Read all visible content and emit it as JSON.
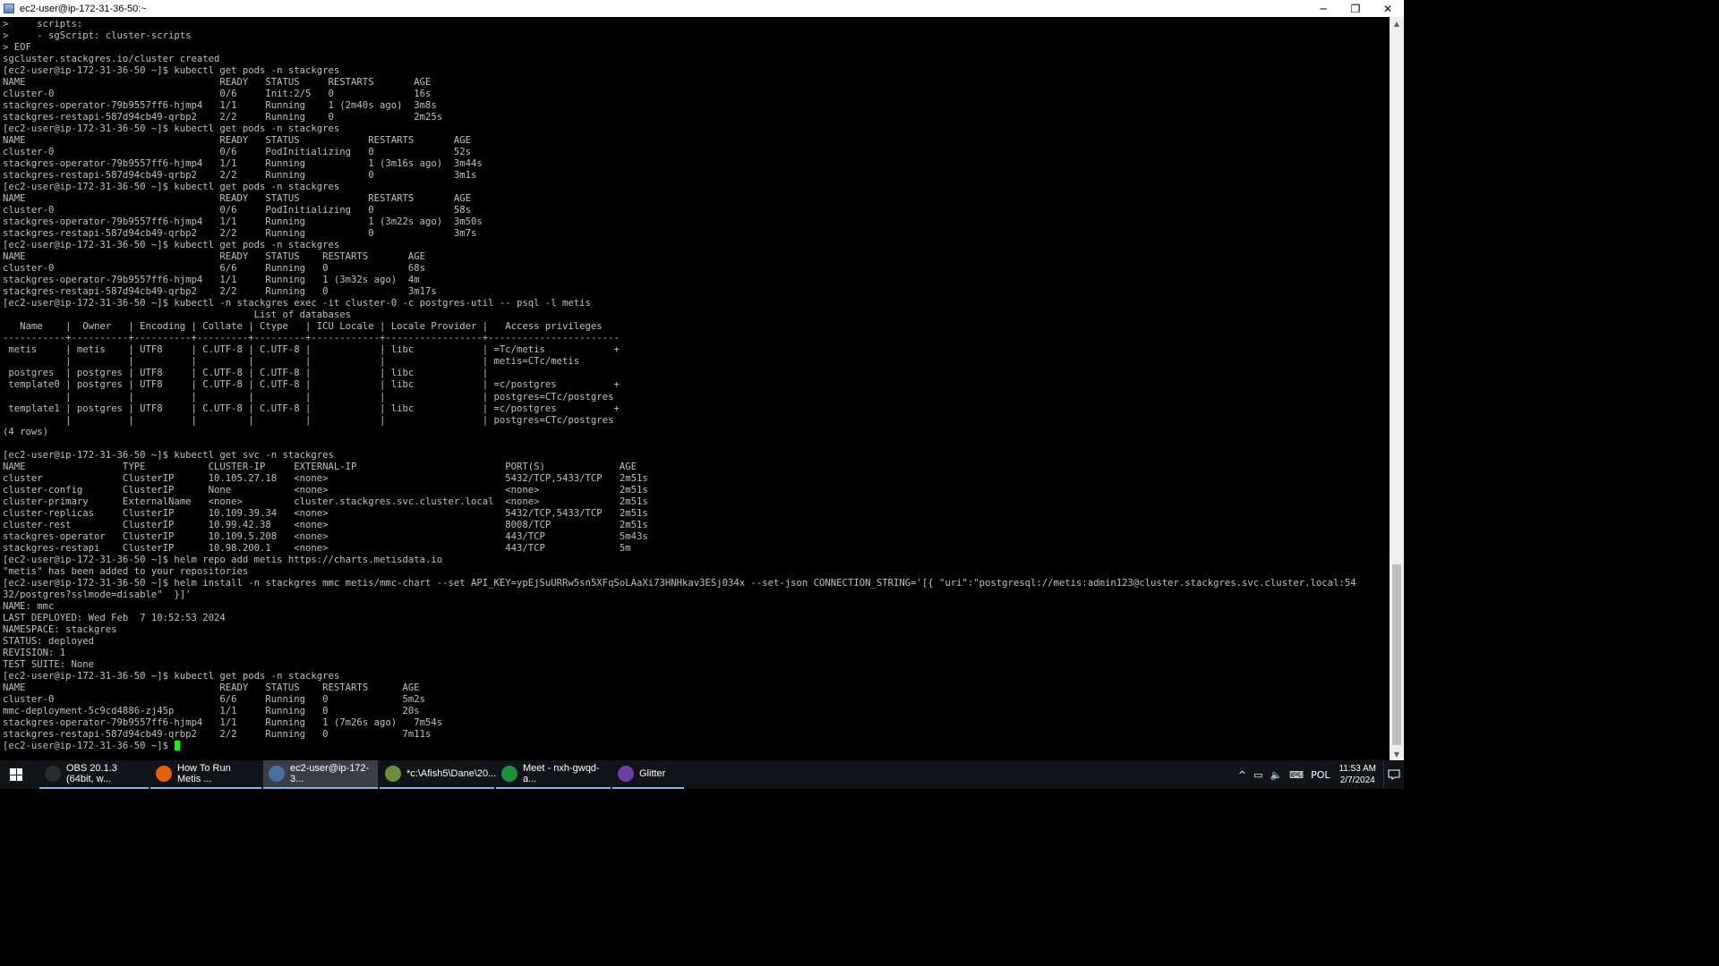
{
  "window": {
    "title": "ec2-user@ip-172-31-36-50:~",
    "minimize": "─",
    "maximize": "❐",
    "close": "✕"
  },
  "terminal": {
    "prompt": "[ec2-user@ip-172-31-36-50 ~]$ ",
    "lines": [
      ">     scripts:",
      ">     - sgScript: cluster-scripts",
      "> EOF",
      "sgcluster.stackgres.io/cluster created",
      "[ec2-user@ip-172-31-36-50 ~]$ kubectl get pods -n stackgres",
      "NAME                                  READY   STATUS     RESTARTS       AGE",
      "cluster-0                             0/6     Init:2/5   0              16s",
      "stackgres-operator-79b9557ff6-hjmp4   1/1     Running    1 (2m40s ago)  3m8s",
      "stackgres-restapi-587d94cb49-qrbp2    2/2     Running    0              2m25s",
      "[ec2-user@ip-172-31-36-50 ~]$ kubectl get pods -n stackgres",
      "NAME                                  READY   STATUS            RESTARTS       AGE",
      "cluster-0                             0/6     PodInitializing   0              52s",
      "stackgres-operator-79b9557ff6-hjmp4   1/1     Running           1 (3m16s ago)  3m44s",
      "stackgres-restapi-587d94cb49-qrbp2    2/2     Running           0              3m1s",
      "[ec2-user@ip-172-31-36-50 ~]$ kubectl get pods -n stackgres",
      "NAME                                  READY   STATUS            RESTARTS       AGE",
      "cluster-0                             0/6     PodInitializing   0              58s",
      "stackgres-operator-79b9557ff6-hjmp4   1/1     Running           1 (3m22s ago)  3m50s",
      "stackgres-restapi-587d94cb49-qrbp2    2/2     Running           0              3m7s",
      "[ec2-user@ip-172-31-36-50 ~]$ kubectl get pods -n stackgres",
      "NAME                                  READY   STATUS    RESTARTS       AGE",
      "cluster-0                             6/6     Running   0              68s",
      "stackgres-operator-79b9557ff6-hjmp4   1/1     Running   1 (3m32s ago)  4m",
      "stackgres-restapi-587d94cb49-qrbp2    2/2     Running   0              3m17s",
      "[ec2-user@ip-172-31-36-50 ~]$ kubectl -n stackgres exec -it cluster-0 -c postgres-util -- psql -l metis",
      "                                            List of databases",
      "   Name    |  Owner   | Encoding | Collate | Ctype   | ICU Locale | Locale Provider |   Access privileges",
      "-----------+----------+----------+---------+---------+------------+-----------------+-----------------------",
      " metis     | metis    | UTF8     | C.UTF-8 | C.UTF-8 |            | libc            | =Tc/metis            +",
      "           |          |          |         |         |            |                 | metis=CTc/metis",
      " postgres  | postgres | UTF8     | C.UTF-8 | C.UTF-8 |            | libc            |",
      " template0 | postgres | UTF8     | C.UTF-8 | C.UTF-8 |            | libc            | =c/postgres          +",
      "           |          |          |         |         |            |                 | postgres=CTc/postgres",
      " template1 | postgres | UTF8     | C.UTF-8 | C.UTF-8 |            | libc            | =c/postgres          +",
      "           |          |          |         |         |            |                 | postgres=CTc/postgres",
      "(4 rows)",
      "",
      "[ec2-user@ip-172-31-36-50 ~]$ kubectl get svc -n stackgres",
      "NAME                 TYPE           CLUSTER-IP     EXTERNAL-IP                          PORT(S)             AGE",
      "cluster              ClusterIP      10.105.27.18   <none>                               5432/TCP,5433/TCP   2m51s",
      "cluster-config       ClusterIP      None           <none>                               <none>              2m51s",
      "cluster-primary      ExternalName   <none>         cluster.stackgres.svc.cluster.local  <none>              2m51s",
      "cluster-replicas     ClusterIP      10.109.39.34   <none>                               5432/TCP,5433/TCP   2m51s",
      "cluster-rest         ClusterIP      10.99.42.38    <none>                               8008/TCP            2m51s",
      "stackgres-operator   ClusterIP      10.109.5.208   <none>                               443/TCP             5m43s",
      "stackgres-restapi    ClusterIP      10.98.200.1    <none>                               443/TCP             5m",
      "[ec2-user@ip-172-31-36-50 ~]$ helm repo add metis https://charts.metisdata.io",
      "\"metis\" has been added to your repositories",
      "[ec2-user@ip-172-31-36-50 ~]$ helm install -n stackgres mmc metis/mmc-chart --set API_KEY=ypEjSuURRw5sn5XFqSoLAaXi73HNHkav3ESj034x --set-json CONNECTION_STRING='[{ \"uri\":\"postgresql://metis:admin123@cluster.stackgres.svc.cluster.local:54",
      "32/postgres?sslmode=disable\"  }]'",
      "NAME: mmc",
      "LAST DEPLOYED: Wed Feb  7 10:52:53 2024",
      "NAMESPACE: stackgres",
      "STATUS: deployed",
      "REVISION: 1",
      "TEST SUITE: None",
      "[ec2-user@ip-172-31-36-50 ~]$ kubectl get pods -n stackgres",
      "NAME                                  READY   STATUS    RESTARTS      AGE",
      "cluster-0                             6/6     Running   0             5m2s",
      "mmc-deployment-5c9cd4886-zj45p        1/1     Running   0             20s",
      "stackgres-operator-79b9557ff6-hjmp4   1/1     Running   1 (7m26s ago)   7m54s",
      "stackgres-restapi-587d94cb49-qrbp2    2/2     Running   0             7m11s"
    ]
  },
  "taskbar": {
    "items": [
      {
        "label": "OBS 20.1.3 (64bit, w...",
        "icon": "obs-icon",
        "color": "#2b2b2b"
      },
      {
        "label": "How To Run Metis ...",
        "icon": "firefox-icon",
        "color": "#e66000"
      },
      {
        "label": "ec2-user@ip-172-3...",
        "icon": "putty-icon",
        "color": "#4a6fa5"
      },
      {
        "label": "*c:\\Afish5\\Dane\\20...",
        "icon": "notepad-icon",
        "color": "#6a8f3a"
      },
      {
        "label": "Meet - nxh-gwqd-a...",
        "icon": "chrome-icon",
        "color": "#1e8e3e"
      },
      {
        "label": "Glitter",
        "icon": "glitter-icon",
        "color": "#6b3fa0"
      }
    ],
    "tray": {
      "language": "POL",
      "time": "11:53 AM",
      "date": "2/7/2024"
    }
  },
  "colors": {
    "terminal_bg": "#000000",
    "terminal_fg": "#c0c0c0",
    "cursor": "#00ff00",
    "selection": "#c0c0c0",
    "taskbar_bg": "#101418",
    "taskbar_accent": "#76b9ed"
  }
}
